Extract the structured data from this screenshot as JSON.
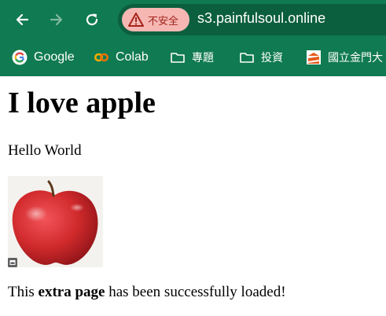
{
  "browser": {
    "security_chip_label": "不安全",
    "url": "s3.painfulsoul.online",
    "colors": {
      "toolbar": "#107a52",
      "omnibox": "#0b5e3e",
      "chip": "#f6b7b3",
      "chip_text": "#a2241c"
    },
    "icons": [
      "back-arrow-icon",
      "forward-arrow-icon",
      "reload-icon",
      "warning-triangle-icon"
    ]
  },
  "bookmarks": [
    {
      "label": "Google",
      "icon": "google-icon"
    },
    {
      "label": "Colab",
      "icon": "colab-icon"
    },
    {
      "label": "專題",
      "icon": "folder-icon"
    },
    {
      "label": "投資",
      "icon": "folder-icon"
    },
    {
      "label": "國立金門大",
      "icon": "university-icon"
    }
  ],
  "page": {
    "heading": "I love apple",
    "paragraph": "Hello World",
    "image": {
      "subject": "red apple"
    },
    "status": {
      "prefix": "This ",
      "bold": "extra page",
      "suffix": " has been successfully loaded!"
    }
  }
}
